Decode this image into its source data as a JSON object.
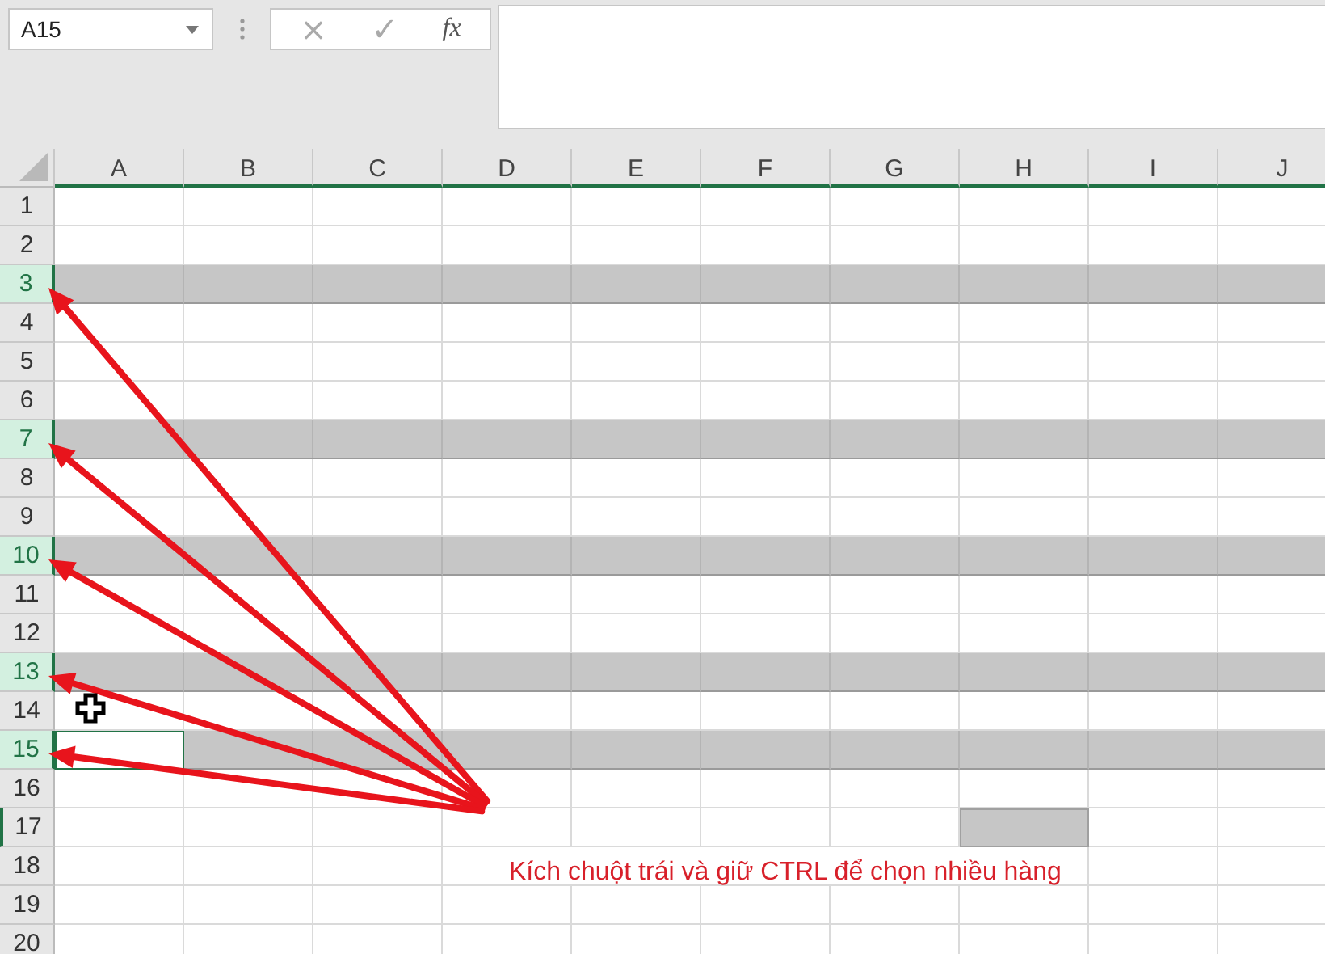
{
  "name_box": {
    "value": "A15"
  },
  "formula_buttons": {
    "cancel": "×",
    "enter": "✓",
    "function": "fx"
  },
  "columns": [
    "A",
    "B",
    "C",
    "D",
    "E",
    "F",
    "G",
    "H",
    "I",
    "J"
  ],
  "rows": [
    {
      "label": "1",
      "selected": false
    },
    {
      "label": "2",
      "selected": false
    },
    {
      "label": "3",
      "selected": true
    },
    {
      "label": "4",
      "selected": false
    },
    {
      "label": "5",
      "selected": false
    },
    {
      "label": "6",
      "selected": false
    },
    {
      "label": "7",
      "selected": true
    },
    {
      "label": "8",
      "selected": false
    },
    {
      "label": "9",
      "selected": false
    },
    {
      "label": "10",
      "selected": true
    },
    {
      "label": "11",
      "selected": false
    },
    {
      "label": "12",
      "selected": false
    },
    {
      "label": "13",
      "selected": true
    },
    {
      "label": "14",
      "selected": false
    },
    {
      "label": "15",
      "selected": true,
      "active": true
    },
    {
      "label": "16",
      "selected": false
    },
    {
      "label": "17",
      "selected": false,
      "selected_cells": [
        false,
        false,
        false,
        false,
        false,
        false,
        false,
        true,
        false,
        false
      ]
    },
    {
      "label": "18",
      "selected": false
    },
    {
      "label": "19",
      "selected": false
    },
    {
      "label": "20",
      "selected": false
    }
  ],
  "annotation": "Kích chuột trái và giữ CTRL để chọn nhiều hàng"
}
